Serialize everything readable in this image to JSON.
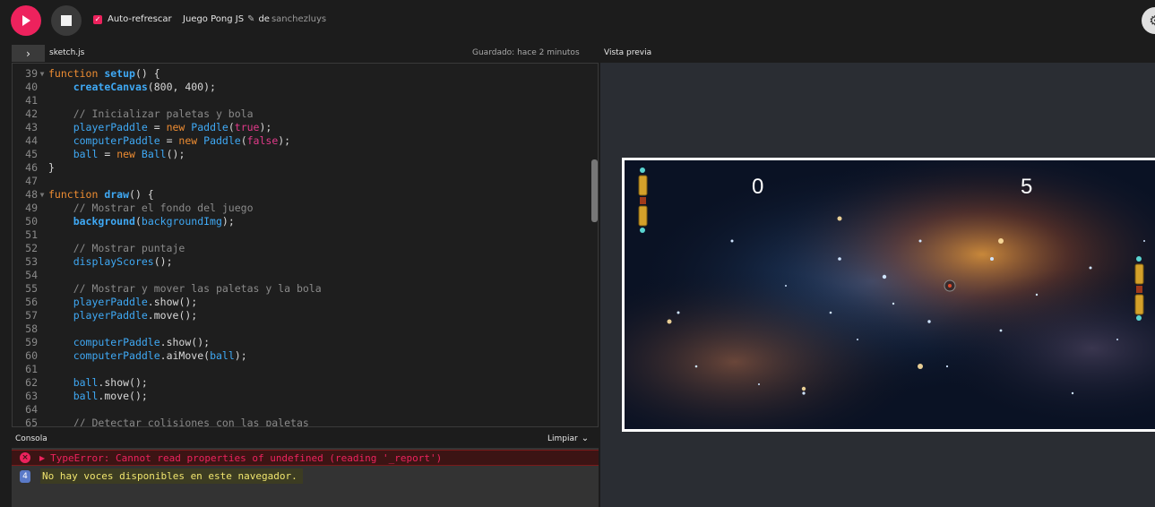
{
  "toolbar": {
    "play_icon": "play-icon",
    "stop_icon": "stop-icon",
    "auto_refresh_label": "Auto-refrescar",
    "auto_refresh_checked": true,
    "project_name": "Juego Pong JS",
    "author_prefix": "de",
    "author": "sanchezluys",
    "settings_icon": "gear-icon"
  },
  "tabs": {
    "file_name": "sketch.js",
    "saved_status": "Guardado: hace 2 minutos",
    "preview_label": "Vista previa"
  },
  "editor": {
    "lines": [
      {
        "n": "39",
        "fold": true
      },
      {
        "n": "40"
      },
      {
        "n": "41"
      },
      {
        "n": "42"
      },
      {
        "n": "43"
      },
      {
        "n": "44"
      },
      {
        "n": "45"
      },
      {
        "n": "46"
      },
      {
        "n": "47"
      },
      {
        "n": "48",
        "fold": true
      },
      {
        "n": "49"
      },
      {
        "n": "50"
      },
      {
        "n": "51"
      },
      {
        "n": "52"
      },
      {
        "n": "53"
      },
      {
        "n": "54"
      },
      {
        "n": "55"
      },
      {
        "n": "56"
      },
      {
        "n": "57"
      },
      {
        "n": "58"
      },
      {
        "n": "59"
      },
      {
        "n": "60"
      },
      {
        "n": "61"
      },
      {
        "n": "62"
      },
      {
        "n": "63"
      },
      {
        "n": "64"
      },
      {
        "n": "65"
      }
    ],
    "code": {
      "l39_kw": "function",
      "l39_fn": "setup",
      "l39_rest": "() {",
      "l40_fn": "createCanvas",
      "l40_rest": "(800, 400);",
      "l42_cm": "// Inicializar paletas y bola",
      "l43_var": "playerPaddle",
      "l43_eq": " = ",
      "l43_new": "new",
      "l43_cls": "Paddle",
      "l43_lit": "true",
      "l44_var": "computerPaddle",
      "l44_eq": " = ",
      "l44_new": "new",
      "l44_cls": "Paddle",
      "l44_lit": "false",
      "l45_var": "ball",
      "l45_eq": " = ",
      "l45_new": "new",
      "l45_cls": "Ball",
      "l45_rest": "();",
      "l46": "}",
      "l48_kw": "function",
      "l48_fn": "draw",
      "l48_rest": "() {",
      "l49_cm": "// Mostrar el fondo del juego",
      "l50_fn": "background",
      "l50_arg": "backgroundImg",
      "l52_cm": "// Mostrar puntaje",
      "l53_fn": "displayScores",
      "l53_rest": "();",
      "l55_cm": "// Mostrar y mover las paletas y la bola",
      "l56_obj": "playerPaddle",
      "l56_m": "show",
      "l57_obj": "playerPaddle",
      "l57_m": "move",
      "l59_obj": "computerPaddle",
      "l59_m": "show",
      "l60_obj": "computerPaddle",
      "l60_m": "aiMove",
      "l60_arg": "ball",
      "l62_obj": "ball",
      "l62_m": "show",
      "l63_obj": "ball",
      "l63_m": "move",
      "l65_cm": "// Detectar colisiones con las paletas"
    }
  },
  "console": {
    "title": "Consola",
    "clear_label": "Limpiar",
    "error_text": "TypeError: Cannot read properties of undefined (reading '_report')",
    "log_count": "4",
    "log_text": "No hay voces disponibles en este navegador."
  },
  "game": {
    "score_left": "0",
    "score_right": "5"
  },
  "colors": {
    "accent": "#ed225d",
    "keyword": "#ed8c32",
    "function": "#3fa9f5",
    "comment": "#8a8a8a",
    "literal": "#e23a8a"
  }
}
